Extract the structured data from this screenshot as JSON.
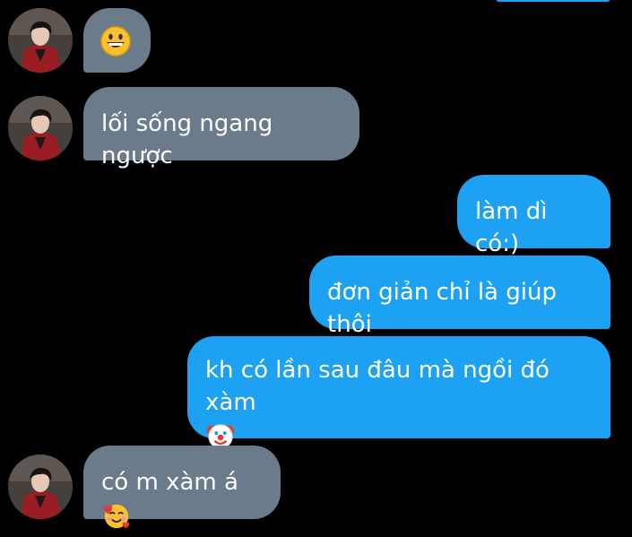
{
  "conversation": {
    "messages": [
      {
        "direction": "incoming",
        "text": "",
        "emoji": "grinning-face"
      },
      {
        "direction": "incoming",
        "text": "lối sống ngang ngược"
      },
      {
        "direction": "outgoing",
        "text": "làm dì có:)"
      },
      {
        "direction": "outgoing",
        "text": "đơn giản chỉ là giúp thôi"
      },
      {
        "direction": "outgoing",
        "text": "kh có lần sau đâu mà ngồi đó xàm",
        "emoji": "clown-face"
      },
      {
        "direction": "incoming",
        "text": "có m xàm á",
        "emoji": "smiling-face-with-hearts"
      }
    ]
  },
  "colors": {
    "background": "#000000",
    "incoming_bubble": "#6b7b8c",
    "outgoing_bubble": "#1da1f2",
    "text": "#ffffff"
  }
}
